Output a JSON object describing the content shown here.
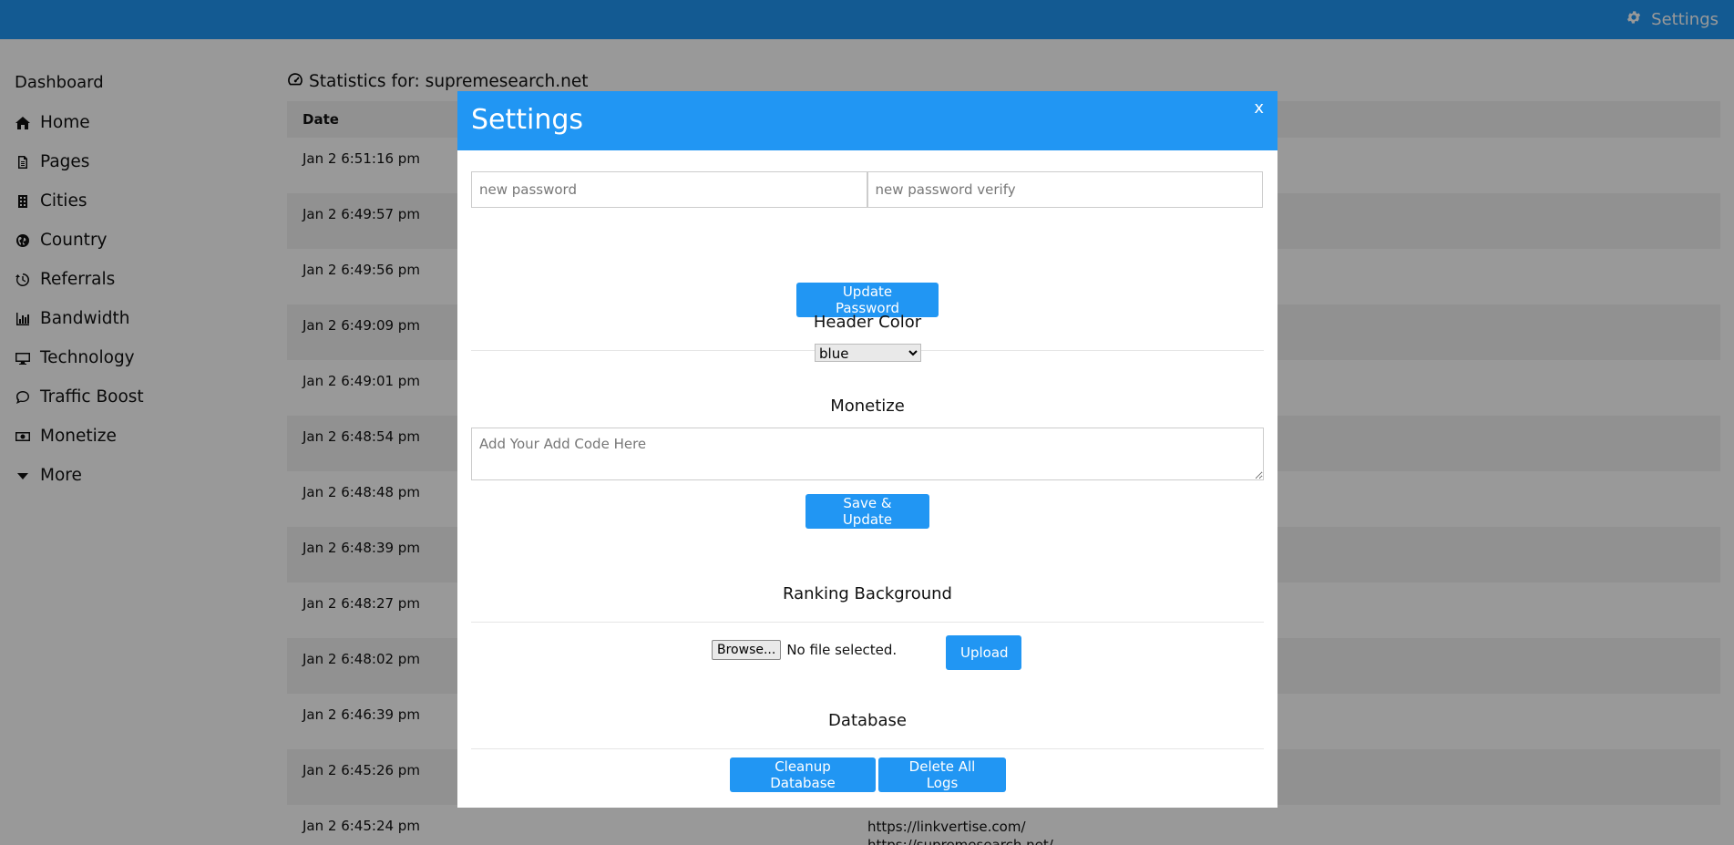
{
  "topbar": {
    "settings_label": "Settings",
    "icon": "gear-icon"
  },
  "sidebar": {
    "title": "Dashboard",
    "items": [
      {
        "label": "Home",
        "icon": "home-icon"
      },
      {
        "label": "Pages",
        "icon": "file-icon"
      },
      {
        "label": "Cities",
        "icon": "building-icon"
      },
      {
        "label": "Country",
        "icon": "globe-icon"
      },
      {
        "label": "Referrals",
        "icon": "history-icon"
      },
      {
        "label": "Bandwidth",
        "icon": "bar-chart-icon"
      },
      {
        "label": "Technology",
        "icon": "desktop-icon"
      },
      {
        "label": "Traffic Boost",
        "icon": "comment-icon"
      },
      {
        "label": "Monetize",
        "icon": "money-icon"
      },
      {
        "label": "More",
        "icon": "caret-down-icon"
      }
    ]
  },
  "main": {
    "stat_title": "Statistics for: supremesearch.net",
    "table_header": "Date",
    "rows": [
      {
        "date": "Jan 2 6:51:16 pm",
        "ref": ""
      },
      {
        "date": "Jan 2 6:49:57 pm",
        "ref": ""
      },
      {
        "date": "Jan 2 6:49:56 pm",
        "ref": ""
      },
      {
        "date": "Jan 2 6:49:09 pm",
        "ref": ""
      },
      {
        "date": "Jan 2 6:49:01 pm",
        "ref": ""
      },
      {
        "date": "Jan 2 6:48:54 pm",
        "ref": ""
      },
      {
        "date": "Jan 2 6:48:48 pm",
        "ref": ""
      },
      {
        "date": "Jan 2 6:48:39 pm",
        "ref": ""
      },
      {
        "date": "Jan 2 6:48:27 pm",
        "ref": ""
      },
      {
        "date": "Jan 2 6:48:02 pm",
        "ref": ""
      },
      {
        "date": "Jan 2 6:46:39 pm",
        "ref": ""
      },
      {
        "date": "Jan 2 6:45:26 pm",
        "ref": ""
      },
      {
        "date": "Jan 2 6:45:24 pm",
        "ref": "https://linkvertise.com/",
        "ref2": "https://supremesearch.net/"
      }
    ]
  },
  "modal": {
    "title": "Settings",
    "close": "x",
    "password_placeholder": "new password",
    "password_verify_placeholder": "new password verify",
    "update_password_label": "Update Password",
    "header_color_label": "Header Color",
    "header_color_value": "blue",
    "monetize_label": "Monetize",
    "ad_code_placeholder": "Add Your Add Code Here",
    "save_update_label": "Save & Update",
    "ranking_bg_label": "Ranking Background",
    "browse_label": "Browse...",
    "no_file_label": "No file selected.",
    "upload_label": "Upload",
    "database_label": "Database",
    "cleanup_label": "Cleanup Database",
    "delete_logs_label": "Delete All Logs"
  },
  "colors": {
    "accent": "#2196f3"
  }
}
